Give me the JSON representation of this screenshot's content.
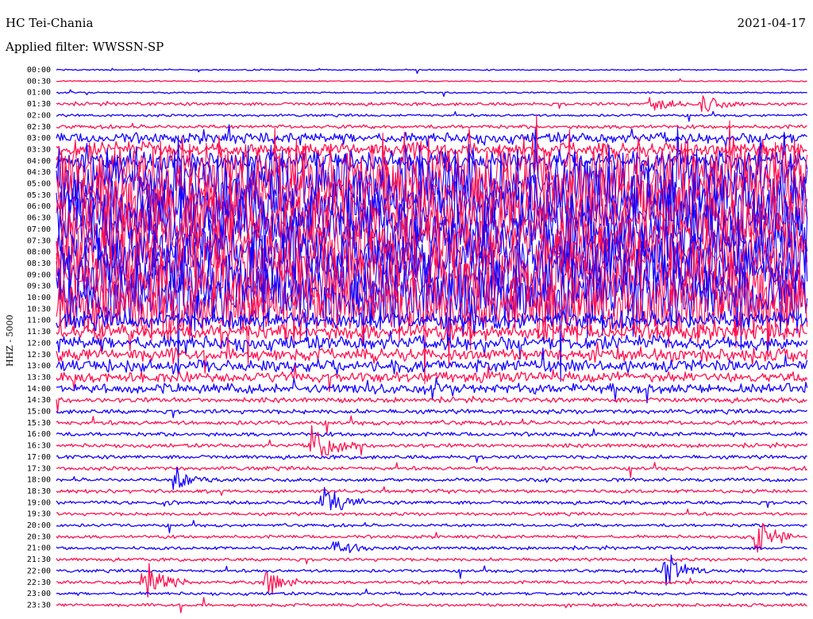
{
  "header": {
    "station": "HC Tei-Chania",
    "date": "2021-04-17",
    "filter_label": "Applied filter:",
    "filter_value": "WWSSN-SP",
    "channel": "HHZ - 5000"
  },
  "colors": {
    "trace_a": "#1400ff",
    "trace_b": "#ff1050",
    "text": "#000000",
    "background": "#ffffff"
  },
  "chart_data": {
    "type": "line",
    "title": "HC Tei-Chania",
    "ylabel": "HHZ - 5000",
    "rows": [
      "00:00",
      "00:30",
      "01:00",
      "01:30",
      "02:00",
      "02:30",
      "03:00",
      "03:30",
      "04:00",
      "04:30",
      "05:00",
      "05:30",
      "06:00",
      "06:30",
      "07:00",
      "07:30",
      "08:00",
      "08:30",
      "09:00",
      "09:30",
      "10:00",
      "10:30",
      "11:00",
      "11:30",
      "12:00",
      "12:30",
      "13:00",
      "13:30",
      "14:00",
      "14:30",
      "15:00",
      "15:30",
      "16:00",
      "16:30",
      "17:00",
      "17:30",
      "18:00",
      "18:30",
      "19:00",
      "19:30",
      "20:00",
      "20:30",
      "21:00",
      "21:30",
      "22:00",
      "22:30",
      "23:00",
      "23:30"
    ],
    "activity_level": [
      0.1,
      0.1,
      0.12,
      0.25,
      0.2,
      0.3,
      0.45,
      0.6,
      0.8,
      1.0,
      1.0,
      1.0,
      1.0,
      1.0,
      1.0,
      1.0,
      1.0,
      1.0,
      1.0,
      1.0,
      1.0,
      0.9,
      0.75,
      0.65,
      0.6,
      0.55,
      0.5,
      0.45,
      0.4,
      0.38,
      0.35,
      0.35,
      0.32,
      0.3,
      0.3,
      0.3,
      0.28,
      0.28,
      0.28,
      0.26,
      0.25,
      0.25,
      0.25,
      0.25,
      0.25,
      0.25,
      0.25,
      0.25
    ],
    "events": [
      {
        "row": "16:30",
        "x_fraction": 0.34,
        "amplitude": 1.0
      },
      {
        "row": "18:00",
        "x_fraction": 0.155,
        "amplitude": 0.5
      },
      {
        "row": "19:00",
        "x_fraction": 0.355,
        "amplitude": 0.8
      },
      {
        "row": "20:30",
        "x_fraction": 0.93,
        "amplitude": 0.8
      },
      {
        "row": "21:00",
        "x_fraction": 0.37,
        "amplitude": 0.4
      },
      {
        "row": "22:00",
        "x_fraction": 0.81,
        "amplitude": 0.8
      },
      {
        "row": "22:30",
        "x_fraction": 0.115,
        "amplitude": 0.9
      },
      {
        "row": "22:30",
        "x_fraction": 0.28,
        "amplitude": 0.5
      },
      {
        "row": "01:30",
        "x_fraction": 0.86,
        "amplitude": 0.4
      },
      {
        "row": "01:30",
        "x_fraction": 0.79,
        "amplitude": 0.3
      }
    ]
  }
}
